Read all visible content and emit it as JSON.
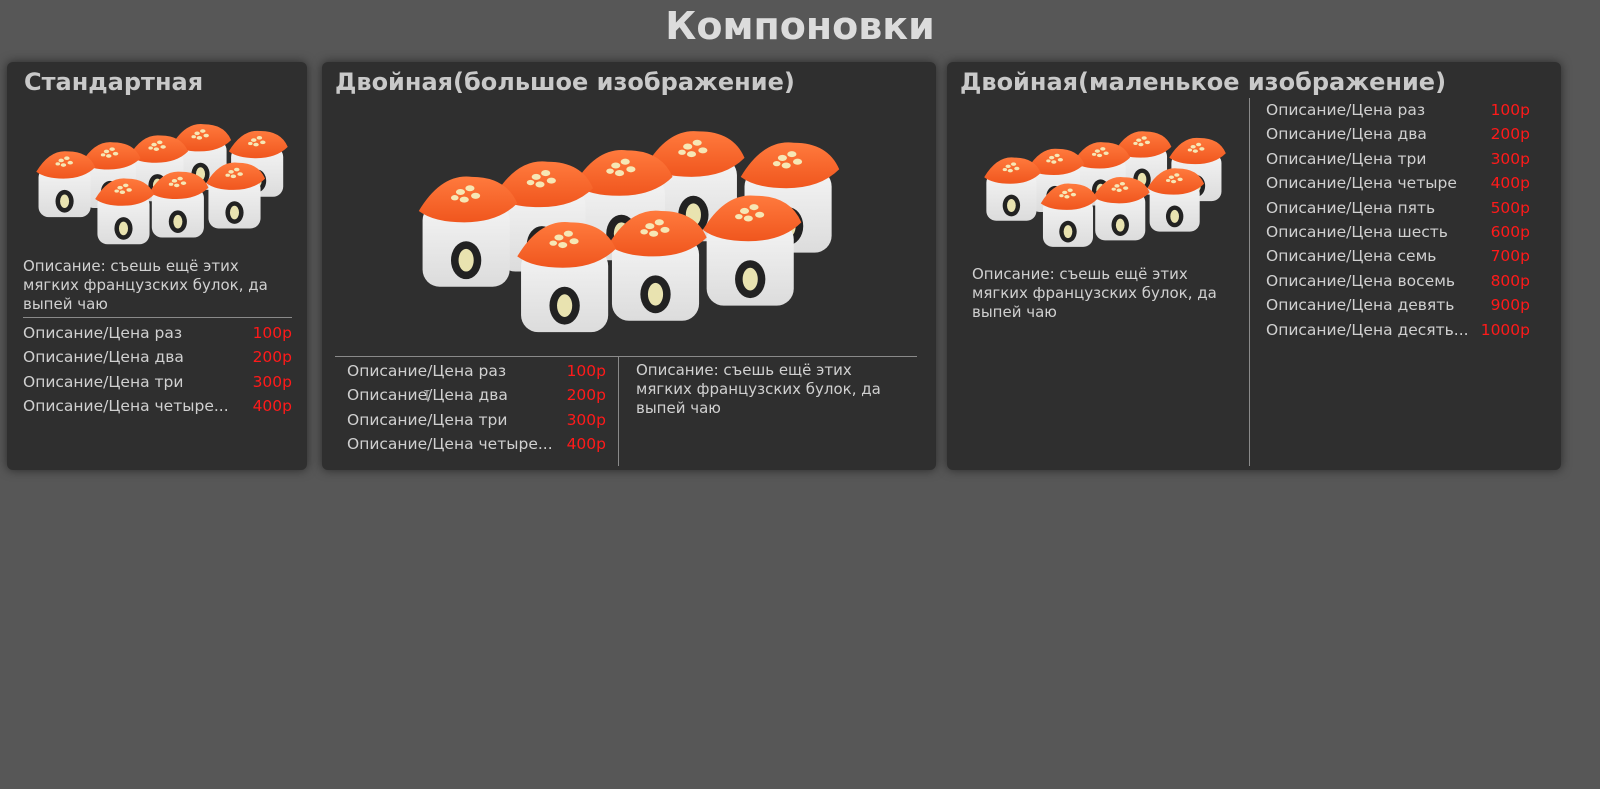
{
  "page": {
    "title": "Компоновки"
  },
  "colors": {
    "background": "#575757",
    "card": "#2f2f2f",
    "price": "#ff1a1a"
  },
  "cards": [
    {
      "title": "Стандартная",
      "image_alt": "sushi-rolls",
      "description": "Описание: съешь ещё этих мягких французских булок, да выпей чаю",
      "items": [
        {
          "name": "Описание/Цена раз",
          "price": "100р"
        },
        {
          "name": "Описание/Цена два",
          "price": "200р"
        },
        {
          "name": "Описание/Цена три",
          "price": "300р"
        },
        {
          "name": "Описание/Цена четыре...",
          "price": "400р"
        }
      ]
    },
    {
      "title": "Двойная(большое изображение)",
      "image_alt": "sushi-rolls",
      "description": "Описание: съешь ещё этих мягких французских булок, да выпей чаю",
      "items": [
        {
          "name": "Описание/Цена раз",
          "price": "100р"
        },
        {
          "name": "Описание/Цена два",
          "price": "200р"
        },
        {
          "name": "Описание/Цена три",
          "price": "300р"
        },
        {
          "name": "Описание/Цена четыре...",
          "price": "400р"
        }
      ]
    },
    {
      "title": "Двойная(маленькое изображение)",
      "image_alt": "sushi-rolls",
      "description": "Описание: съешь ещё этих мягких французских булок, да выпей чаю",
      "items": [
        {
          "name": "Описание/Цена раз",
          "price": "100р"
        },
        {
          "name": "Описание/Цена два",
          "price": "200р"
        },
        {
          "name": "Описание/Цена три",
          "price": "300р"
        },
        {
          "name": "Описание/Цена четыре",
          "price": "400р"
        },
        {
          "name": "Описание/Цена пять",
          "price": "500р"
        },
        {
          "name": "Описание/Цена шесть",
          "price": "600р"
        },
        {
          "name": "Описание/Цена семь",
          "price": "700р"
        },
        {
          "name": "Описание/Цена восемь",
          "price": "800р"
        },
        {
          "name": "Описание/Цена девять",
          "price": "900р"
        },
        {
          "name": "Описание/Цена десять...",
          "price": "1000р"
        }
      ]
    }
  ]
}
